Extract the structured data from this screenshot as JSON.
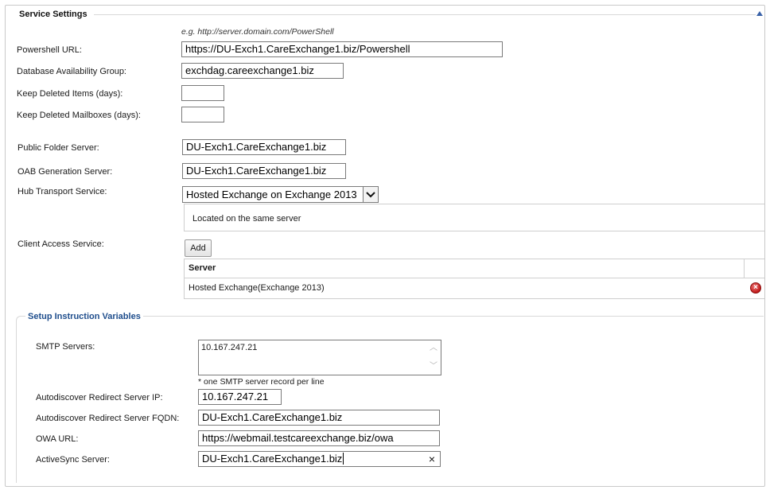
{
  "service_settings": {
    "title": "Service Settings",
    "hint": "e.g. http://server.domain.com/PowerShell",
    "powershell_url": {
      "label": "Powershell URL:",
      "value": "https://DU-Exch1.CareExchange1.biz/Powershell"
    },
    "dag": {
      "label": "Database Availability Group:",
      "value": "exchdag.careexchange1.biz"
    },
    "keep_deleted_items": {
      "label": "Keep Deleted Items (days):",
      "value": ""
    },
    "keep_deleted_mailboxes": {
      "label": "Keep Deleted Mailboxes (days):",
      "value": ""
    },
    "public_folder_server": {
      "label": "Public Folder Server:",
      "value": "DU-Exch1.CareExchange1.biz"
    },
    "oab_generation_server": {
      "label": "OAB Generation Server:",
      "value": "DU-Exch1.CareExchange1.biz"
    },
    "hub_transport": {
      "label": "Hub Transport Service:",
      "selected": "Hosted Exchange on Exchange 2013",
      "note": "Located on the same server"
    },
    "client_access": {
      "label": "Client Access Service:",
      "add_label": "Add",
      "column_header": "Server",
      "rows": [
        {
          "server": "Hosted Exchange(Exchange 2013)"
        }
      ]
    }
  },
  "setup_instruction_variables": {
    "title": "Setup Instruction Variables",
    "smtp_servers": {
      "label": "SMTP Servers:",
      "value": "10.167.247.21",
      "hint": "* one SMTP server record per line"
    },
    "autodiscover_ip": {
      "label": "Autodiscover Redirect Server IP:",
      "value": "10.167.247.21"
    },
    "autodiscover_fqdn": {
      "label": "Autodiscover Redirect Server FQDN:",
      "value": "DU-Exch1.CareExchange1.biz"
    },
    "owa_url": {
      "label": "OWA URL:",
      "value": "https://webmail.testcareexchange.biz/owa"
    },
    "activesync_server": {
      "label": "ActiveSync Server:",
      "value": "DU-Exch1.CareExchange1.biz"
    }
  },
  "icons": {
    "collapse": "collapse-up-icon",
    "dropdown": "chevron-down-icon",
    "delete": "delete-circle-icon",
    "clear": "clear-x-icon"
  },
  "colors": {
    "subsection_title": "#1e4d8c",
    "collapse_icon": "#3a62a8",
    "delete_icon": "#c21b1b"
  }
}
